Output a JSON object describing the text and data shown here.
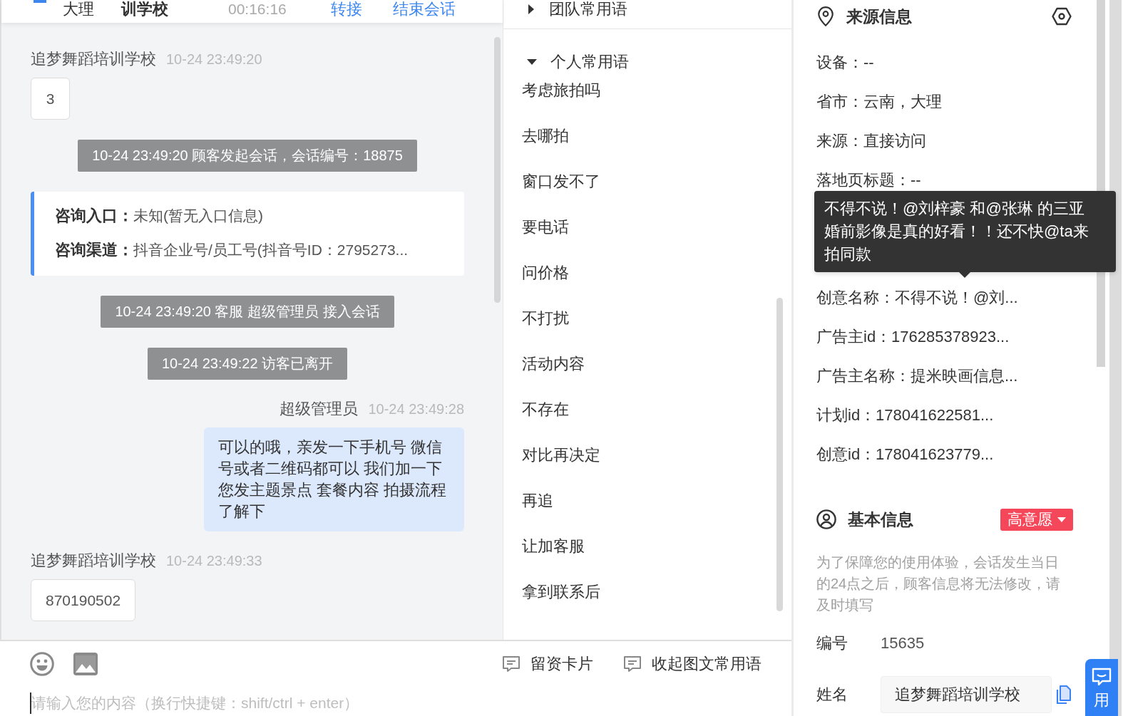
{
  "chat_header": {
    "visitor_city": "大理",
    "visitor_name": "训学校",
    "duration": "00:16:16",
    "actions": [
      {
        "label": "转接"
      },
      {
        "label": "结束会话"
      }
    ]
  },
  "messages": [
    {
      "kind": "visitor",
      "sender": "追梦舞蹈培训学校",
      "time": "10-24 23:49:20",
      "text": "3"
    },
    {
      "kind": "system",
      "text": "10-24 23:49:20 顾客发起会话，会话编号：18875"
    },
    {
      "kind": "info",
      "fields": [
        {
          "label": "咨询入口：",
          "value": "未知(暂无入口信息)"
        },
        {
          "label": "咨询渠道：",
          "value": "抖音企业号/员工号(抖音号ID：2795273..."
        }
      ]
    },
    {
      "kind": "system",
      "text": "10-24 23:49:20 客服 超级管理员 接入会话"
    },
    {
      "kind": "system",
      "text": "10-24 23:49:22 访客已离开"
    },
    {
      "kind": "agent",
      "sender": "超级管理员",
      "time": "10-24 23:49:28",
      "text": "可以的哦，亲发一下手机号 微信号或者二维码都可以 我们加一下您发主题景点 套餐内容 拍摄流程了解下"
    },
    {
      "kind": "visitor",
      "sender": "追梦舞蹈培训学校",
      "time": "10-24 23:49:33",
      "text": "870190502"
    }
  ],
  "phrase_groups": [
    {
      "title": "团队常用语",
      "expanded": false
    },
    {
      "title": "个人常用语",
      "expanded": true,
      "items": [
        "考虑旅拍吗",
        "去哪拍",
        "窗口发不了",
        "要电话",
        "问价格",
        "不打扰",
        "活动内容",
        "不存在",
        "对比再决定",
        "再追",
        "让加客服",
        "拿到联系后"
      ]
    }
  ],
  "composer": {
    "actions": [
      {
        "label": "留资卡片"
      },
      {
        "label": "收起图文常用语"
      }
    ],
    "placeholder": "请输入您的内容（换行快捷键：shift/ctrl + enter）"
  },
  "source_info": {
    "title": "来源信息",
    "rows": [
      {
        "text": "设备：--"
      },
      {
        "text": "省市：云南，大理"
      },
      {
        "text": "来源：直接访问"
      },
      {
        "text": "落地页标题：--"
      },
      {
        "text": "创意名称：不得不说！@刘...",
        "tooltip": "不得不说！@刘梓豪 和@张琳 的三亚婚前影像是真的好看！！还不快@ta来拍同款"
      },
      {
        "text": "广告主id：176285378923..."
      },
      {
        "text": "广告主名称：提米映画信息..."
      },
      {
        "text": "计划id：178041622581..."
      },
      {
        "text": "创意id：178041623779..."
      }
    ]
  },
  "basic_info": {
    "title": "基本信息",
    "intent": "高意愿",
    "notice": "为了保障您的使用体验，会话发生当日的24点之后，顾客信息将无法修改，请及时填写",
    "fields": [
      {
        "kind": "text",
        "label": "编号",
        "value": "15635"
      },
      {
        "kind": "input",
        "label": "姓名",
        "value": "追梦舞蹈培训学校"
      }
    ]
  },
  "float_button": {
    "label": "用"
  }
}
